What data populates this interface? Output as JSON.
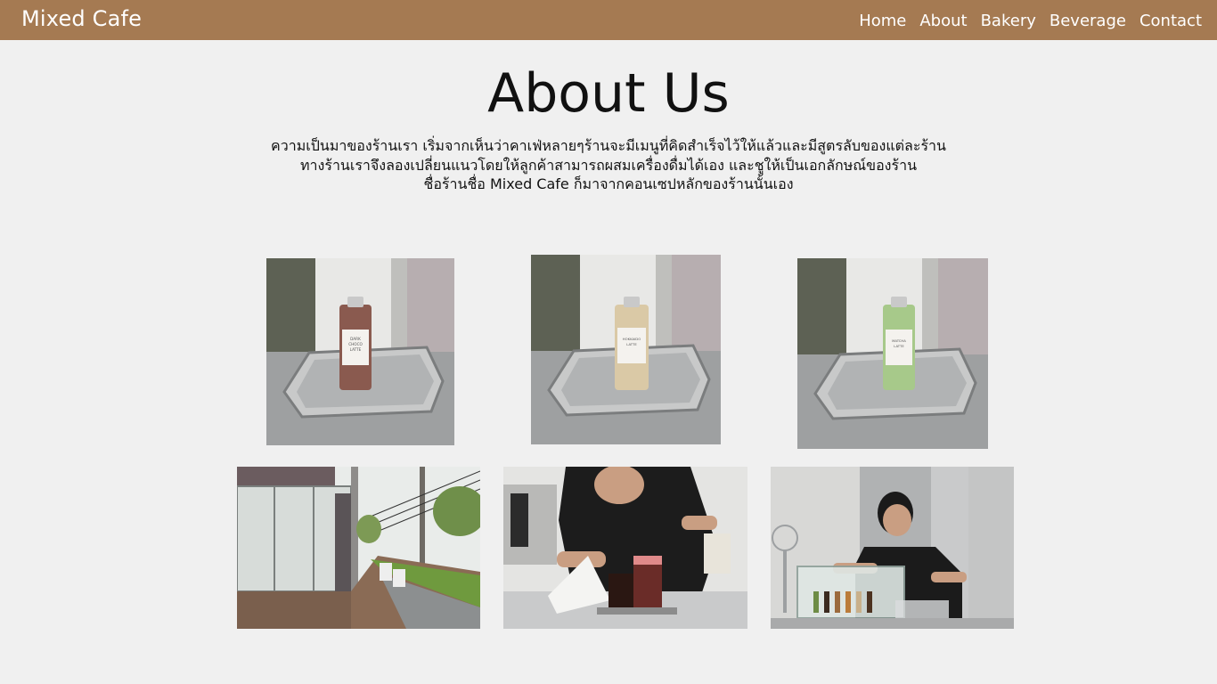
{
  "brand": "Mixed Cafe",
  "nav": {
    "items": [
      {
        "label": "Home"
      },
      {
        "label": "About"
      },
      {
        "label": "Bakery"
      },
      {
        "label": "Beverage"
      },
      {
        "label": "Contact"
      }
    ]
  },
  "colors": {
    "navbar": "#a57a52",
    "background": "#f0f0f0"
  },
  "about": {
    "title": "About Us",
    "paragraph_lines": [
      "ความเป็นมาของร้านเรา เริ่มจากเห็นว่าคาเฟ่หลายๆร้านจะมีเมนูที่คิดสำเร็จไว้ให้แล้วและมีสูตรลับของแต่ละร้าน",
      "ทางร้านเราจึงลองเปลี่ยนแนวโดยให้ลูกค้าสามารถผสมเครื่องดื่มได้เอง และชูให้เป็นเอกลักษณ์ของร้าน",
      "ชื่อร้านชื่อ Mixed Cafe ก็มาจากคอนเซปหลักของร้านนั้นเอง"
    ]
  },
  "photos": [
    {
      "name": "dark-choco-latte-photo",
      "bottle_label_lines": [
        "DARK",
        "CHOCO",
        "LATTE"
      ]
    },
    {
      "name": "hokkaido-latte-photo",
      "bottle_label_lines": [
        "HOKKAIDO",
        "LATTE"
      ]
    },
    {
      "name": "matcha-latte-photo",
      "bottle_label_lines": [
        "MATCHA",
        "LATTE"
      ]
    },
    {
      "name": "cafe-storefront-photo"
    },
    {
      "name": "barista-preparing-drinks-photo"
    },
    {
      "name": "barista-at-counter-photo"
    }
  ]
}
